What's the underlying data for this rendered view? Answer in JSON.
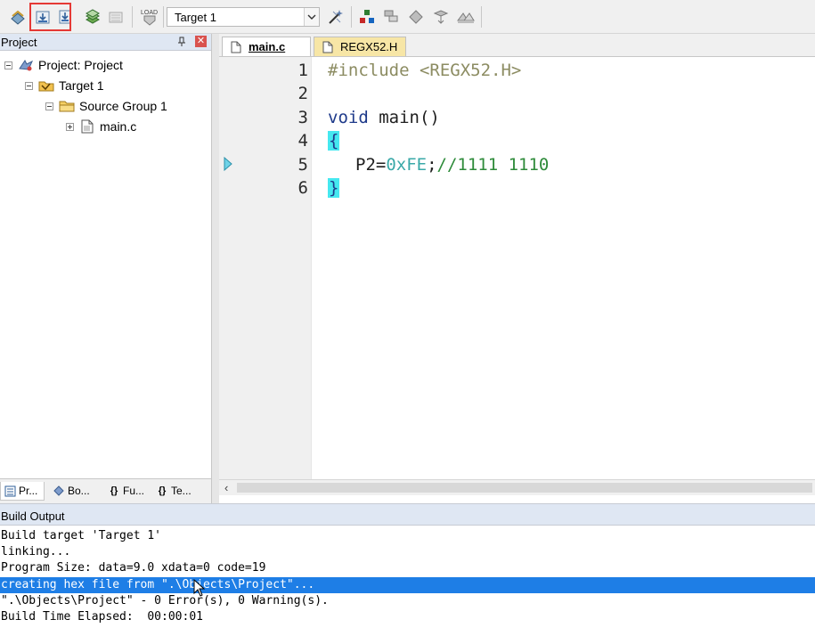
{
  "toolbar": {
    "target_value": "Target 1",
    "load_label": "LOAD"
  },
  "project_panel": {
    "title": "Project",
    "tree": [
      {
        "label": "Project: Project",
        "icon": "project-icon"
      },
      {
        "label": "Target 1",
        "icon": "target-icon"
      },
      {
        "label": "Source Group 1",
        "icon": "folder-icon"
      },
      {
        "label": "main.c",
        "icon": "file-icon"
      }
    ],
    "tabs": [
      {
        "label": "Pr...",
        "icon": "project-tab-icon"
      },
      {
        "label": "Bo...",
        "icon": "books-tab-icon"
      },
      {
        "label": "Fu...",
        "icon": "functions-tab-icon",
        "glyph": "{}"
      },
      {
        "label": "Te...",
        "icon": "templates-tab-icon",
        "glyph": "{}"
      }
    ]
  },
  "editor": {
    "tabs": [
      {
        "label": "main.c",
        "active": true
      },
      {
        "label": "REGX52.H",
        "active": false
      }
    ],
    "line_numbers": [
      "1",
      "2",
      "3",
      "4",
      "5",
      "6"
    ],
    "code": {
      "l1_pre": "#include <REGX52.H>",
      "l3_kw": "void",
      "l3_rest": " main()",
      "l4_brace": "{",
      "l5_ident": "P2=",
      "l5_num": "0xFE",
      "l5_semi": ";",
      "l5_comment": "//1111 1110",
      "l6_brace": "}"
    }
  },
  "build_output": {
    "title": "Build Output",
    "lines": [
      "Build target 'Target 1'",
      "linking...",
      "Program Size: data=9.0 xdata=0 code=19",
      "creating hex file from \".\\Objects\\Project\"...",
      "\".\\Objects\\Project\" - 0 Error(s), 0 Warning(s).",
      "Build Time Elapsed:  00:00:01"
    ],
    "selected_line": 3
  },
  "colors": {
    "selection": "#1e7ee6",
    "highlight_box": "#e53935",
    "brace_match": "#45e8f0",
    "header_tab_yellow": "#f7e6a6"
  }
}
